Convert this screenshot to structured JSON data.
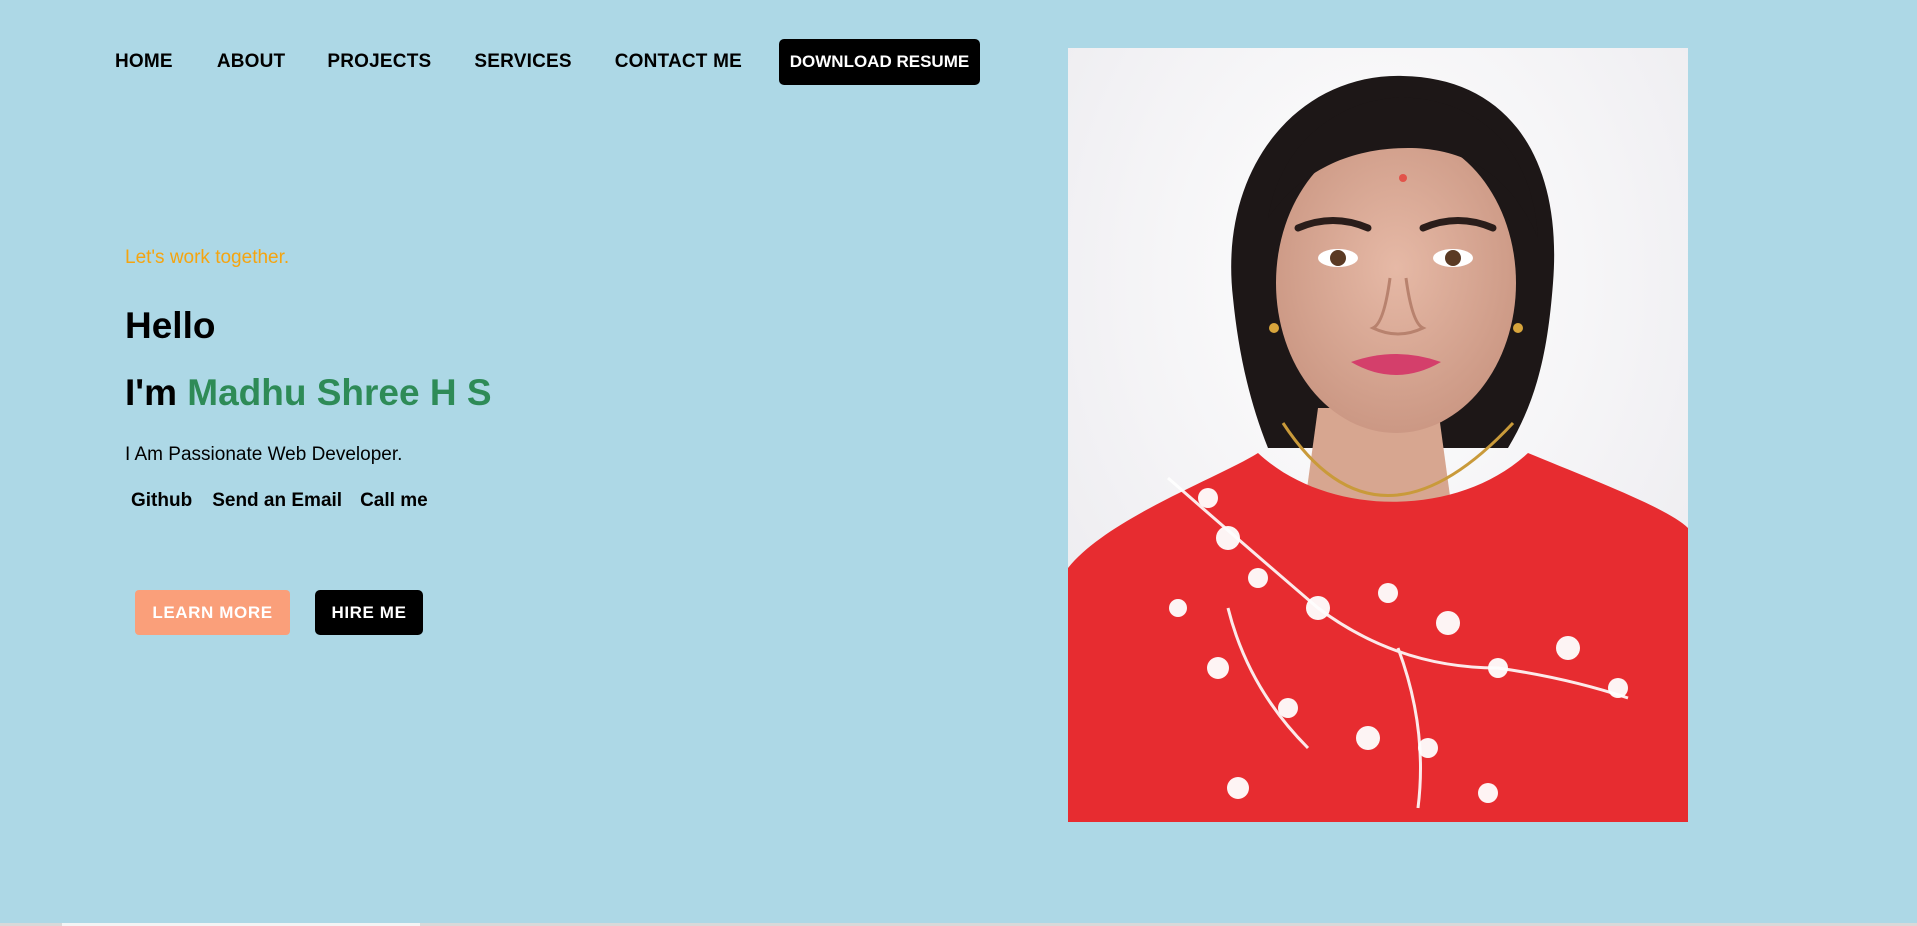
{
  "nav": {
    "items": [
      {
        "label": "HOME"
      },
      {
        "label": "ABOUT"
      },
      {
        "label": "PROJECTS"
      },
      {
        "label": "SERVICES"
      },
      {
        "label": "CONTACT ME"
      }
    ],
    "resume_button": "DOWNLOAD RESUME"
  },
  "hero": {
    "tagline": "Let's work together.",
    "greeting": "Hello",
    "intro_prefix": "I'm ",
    "name": "Madhu Shree H S",
    "description": "I Am Passionate Web Developer.",
    "links": {
      "github": "Github",
      "email": "Send an Email",
      "phone": "Call me"
    },
    "learn_more_button": "LEARN MORE",
    "hire_button": "HIRE ME"
  },
  "colors": {
    "background": "#add8e6",
    "tagline": "#f5a40f",
    "name": "#2e8b57",
    "learn_more": "#fa9f7a",
    "dark_button": "#000000"
  },
  "portrait": {
    "subject": "portrait-photo"
  }
}
